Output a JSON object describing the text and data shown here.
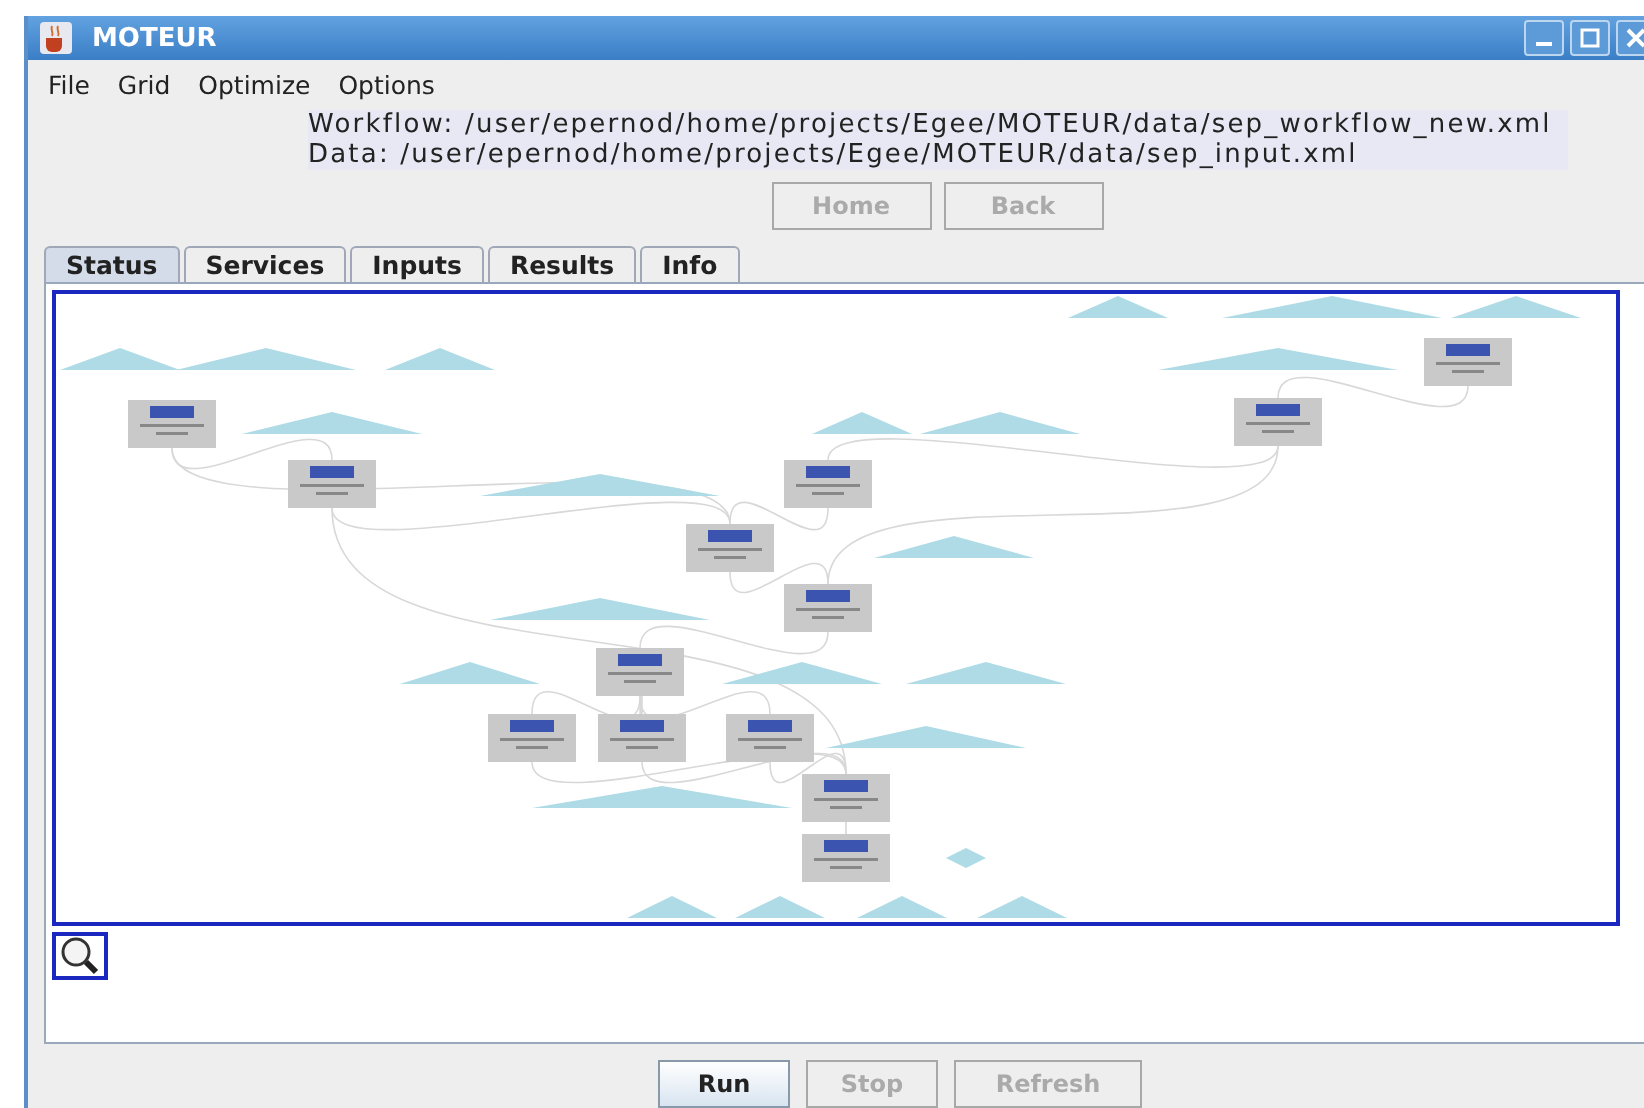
{
  "window": {
    "title": "MOTEUR"
  },
  "menu": [
    {
      "label": "File"
    },
    {
      "label": "Grid"
    },
    {
      "label": "Optimize"
    },
    {
      "label": "Options"
    }
  ],
  "info": {
    "workflow": "Workflow: /user/epernod/home/projects/Egee/MOTEUR/data/sep_workflow_new.xml",
    "data": "Data: /user/epernod/home/projects/Egee/MOTEUR/data/sep_input.xml"
  },
  "nav_buttons": [
    {
      "label": "Home",
      "disabled": true
    },
    {
      "label": "Back",
      "disabled": true
    }
  ],
  "tabs": [
    {
      "label": "Status",
      "selected": true
    },
    {
      "label": "Services",
      "selected": false
    },
    {
      "label": "Inputs",
      "selected": false
    },
    {
      "label": "Results",
      "selected": false
    },
    {
      "label": "Info",
      "selected": false
    }
  ],
  "buttons": [
    {
      "label": "Run",
      "disabled": false
    },
    {
      "label": "Stop",
      "disabled": true
    },
    {
      "label": "Refresh",
      "disabled": true
    }
  ]
}
